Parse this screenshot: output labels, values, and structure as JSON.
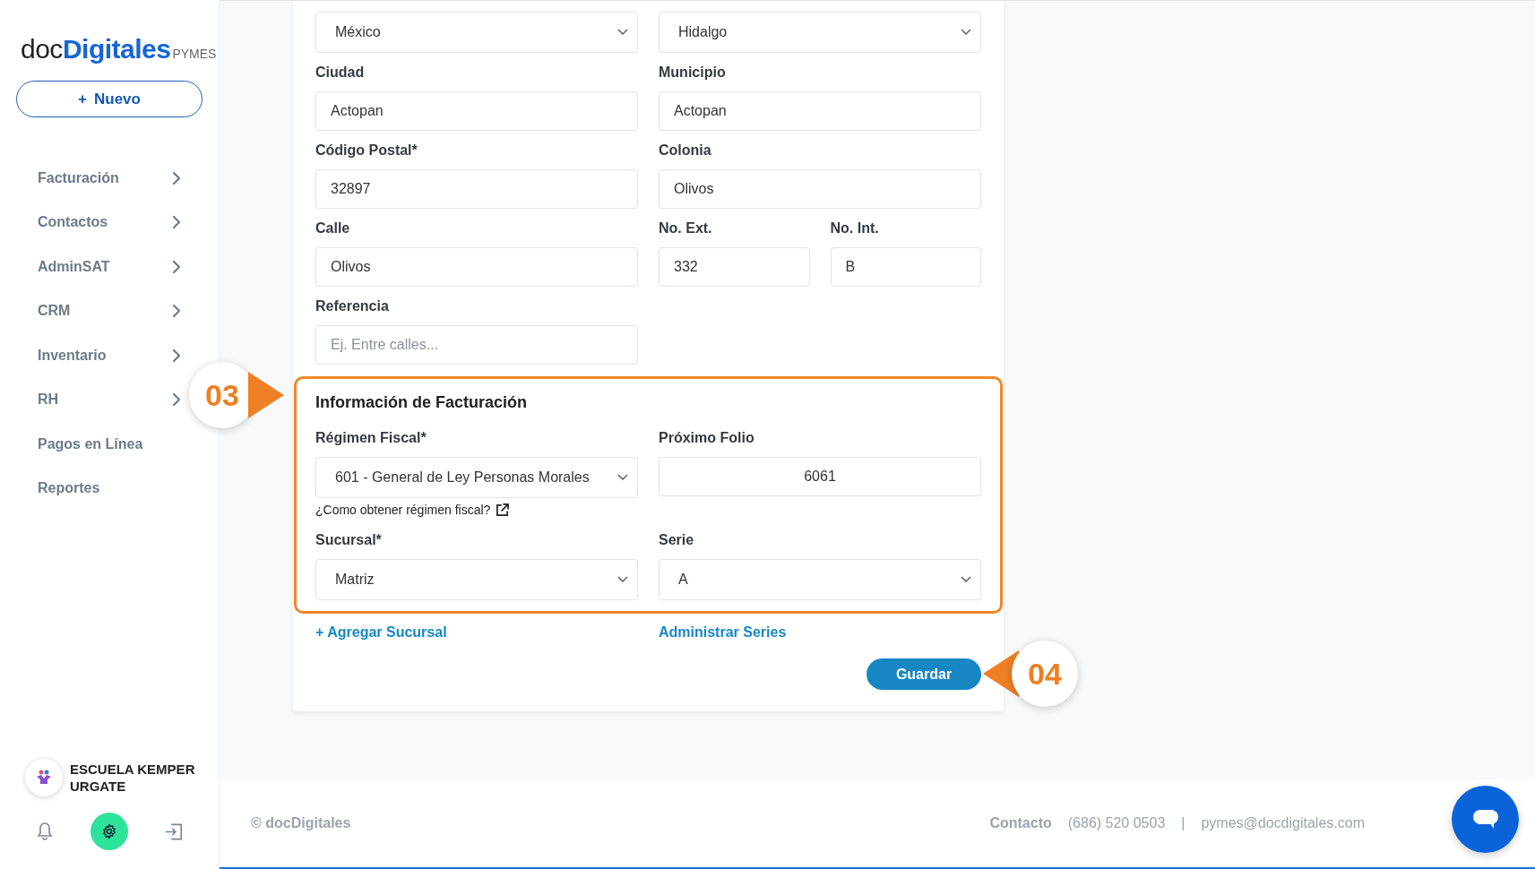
{
  "logo": {
    "prefix": "doc",
    "name": "Digitales",
    "suffix": "PYMES"
  },
  "new_button": {
    "icon": "+",
    "label": "Nuevo"
  },
  "sidebar": {
    "items": [
      {
        "label": "Facturación",
        "has_submenu": true
      },
      {
        "label": "Contactos",
        "has_submenu": true
      },
      {
        "label": "AdminSAT",
        "has_submenu": true
      },
      {
        "label": "CRM",
        "has_submenu": true
      },
      {
        "label": "Inventario",
        "has_submenu": true
      },
      {
        "label": "RH",
        "has_submenu": true
      },
      {
        "label": "Pagos en Línea",
        "has_submenu": false
      },
      {
        "label": "Reportes",
        "has_submenu": false
      }
    ]
  },
  "account": {
    "name": "ESCUELA KEMPER URGATE"
  },
  "address_rows": [
    {
      "fields": [
        {
          "kind": "select",
          "value": "México"
        },
        {
          "kind": "select",
          "value": "Hidalgo"
        }
      ]
    },
    {
      "fields": [
        {
          "kind": "text",
          "label": "Ciudad",
          "value": "Actopan"
        },
        {
          "kind": "text",
          "label": "Municipio",
          "value": "Actopan"
        }
      ]
    },
    {
      "fields": [
        {
          "kind": "text",
          "label": "Código Postal*",
          "value": "32897"
        },
        {
          "kind": "text",
          "label": "Colonia",
          "value": "Olivos"
        }
      ]
    },
    {
      "fields": [
        {
          "kind": "text",
          "label": "Calle",
          "value": "Olivos"
        },
        {
          "kind": "text",
          "label": "No. Ext.",
          "value": "332"
        },
        {
          "kind": "text",
          "label": "No. Int.",
          "value": "B"
        }
      ]
    },
    {
      "fields": [
        {
          "kind": "text",
          "label": "Referencia",
          "placeholder": "Ej. Entre calles..."
        }
      ]
    }
  ],
  "billing": {
    "title": "Información de Facturación",
    "highlighted": true,
    "rows": [
      {
        "fields": [
          {
            "kind": "select",
            "label": "Régimen Fiscal*",
            "value": "601 - General de Ley Personas Morales",
            "help": "¿Como obtener régimen fiscal?"
          },
          {
            "kind": "number",
            "label": "Próximo Folio",
            "value": "6061"
          }
        ]
      },
      {
        "fields": [
          {
            "kind": "select",
            "label": "Sucursal*",
            "value": "Matriz"
          },
          {
            "kind": "select",
            "label": "Serie",
            "value": "A"
          }
        ]
      }
    ]
  },
  "links": [
    "+ Agregar Sucursal",
    "Administrar Series"
  ],
  "save_button": "Guardar",
  "callouts": [
    {
      "label": "03",
      "kind": "right"
    },
    {
      "label": "04",
      "kind": "left"
    }
  ],
  "footer": {
    "copyright": "© docDigitales",
    "contact_label": "Contacto",
    "phone": "(686) 520 0503",
    "separator": "|",
    "email": "pymes@docdigitales.com"
  }
}
